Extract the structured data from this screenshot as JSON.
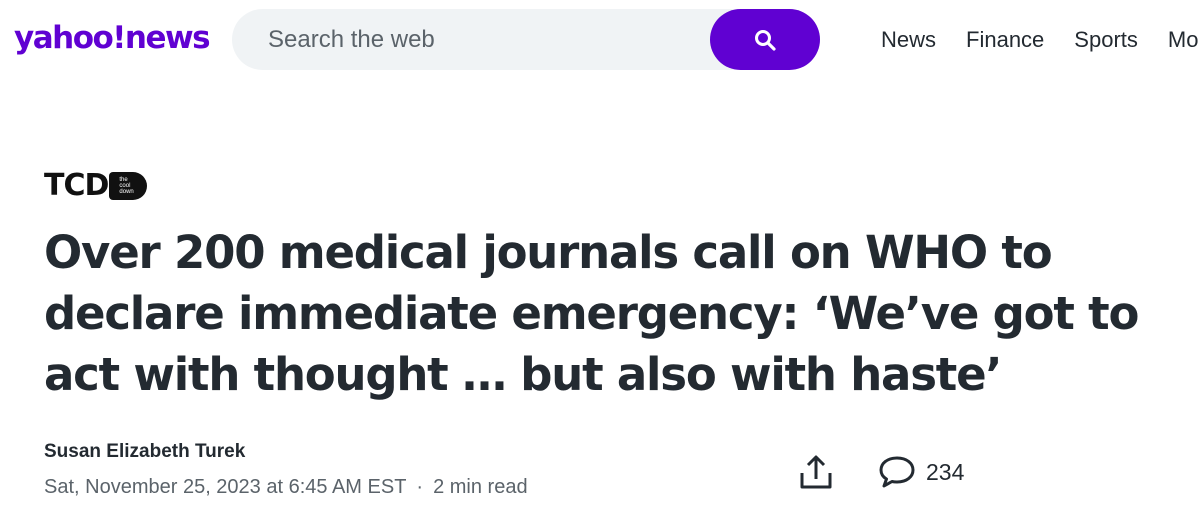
{
  "header": {
    "logo_text": "yahoo!news",
    "brand_color": "#6001d2",
    "search": {
      "placeholder": "Search the web",
      "button_icon": "search-icon"
    },
    "nav": [
      {
        "label": "News"
      },
      {
        "label": "Finance"
      },
      {
        "label": "Sports"
      },
      {
        "label": "Mor"
      }
    ]
  },
  "article": {
    "publisher": {
      "letters": "TCD",
      "pill_lines": [
        "the",
        "cool",
        "down"
      ]
    },
    "headline": "Over 200 medical journals call on WHO to declare immediate emergency: ‘We’ve got to act with thought … but also with haste’",
    "author": "Susan Elizabeth Turek",
    "date": "Sat, November 25, 2023 at 6:45 AM EST",
    "separator": "·",
    "read_time": "2 min read",
    "share_icon": "share-icon",
    "comment_icon": "comment-icon",
    "comment_count": "234"
  }
}
